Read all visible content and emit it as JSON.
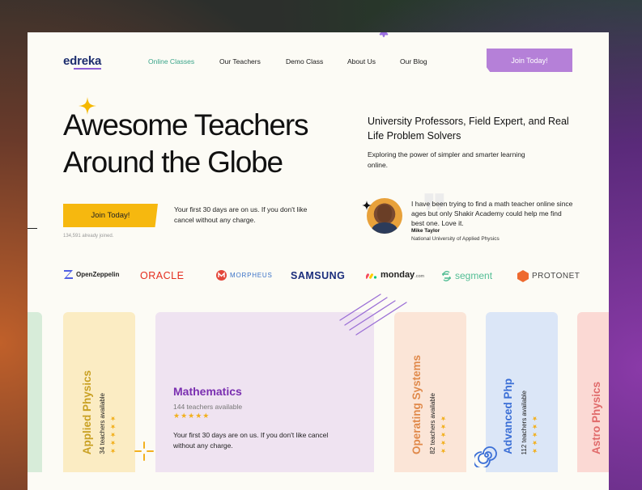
{
  "nav": {
    "logo": "edreka",
    "links": [
      "Online Classes",
      "Our Teachers",
      "Demo Class",
      "About Us",
      "Our Blog"
    ],
    "cta": "Join Today!"
  },
  "hero": {
    "title": "Awesome Teachers\nAround the Globe",
    "cta": "Join Today!",
    "joined": "134,591 already joined.",
    "trial_note": "Your first 30 days are on us. If you don't like cancel without any charge.",
    "subhead": "University Professors, Field Expert, and Real Life Problem Solvers",
    "subtext": "Exploring the power of simpler and smarter learning online."
  },
  "testimonial": {
    "quote": "I have been trying to find a math teacher online since ages but only Shakir Academy could help me find best one. Love it.",
    "name": "Mike Taylor",
    "org": "National University of Applied Physics"
  },
  "brands": [
    "OpenZeppelin",
    "ORACLE",
    "MORPHEUS",
    "SAMSUNG",
    "monday",
    ".com",
    "segment",
    "PROTONET"
  ],
  "courses": [
    {
      "title": "Applied Physics",
      "count": "34 teachers available",
      "stars": "★★★★★",
      "color": "#c9a022",
      "bg": "#fbecc3"
    },
    {
      "title": "Mathematics",
      "count": "144 teachers available",
      "stars": "★★★★★",
      "note": "Your first 30 days are on us. If you don't like cancel without any charge.",
      "color": "#7a2fb0",
      "bg": "#efe3f1"
    },
    {
      "title": "Operating Systems",
      "count": "82 teachers available",
      "stars": "★★★★★",
      "color": "#e0894a",
      "bg": "#fbe5d7"
    },
    {
      "title": "Advanced Php",
      "count": "112 teachers available",
      "stars": "★★★★★",
      "color": "#3b6fd6",
      "bg": "#dbe6f7"
    },
    {
      "title": "Astro Physics",
      "count": "",
      "stars": "",
      "color": "#e06a6a",
      "bg": "#fbd9d4"
    }
  ]
}
